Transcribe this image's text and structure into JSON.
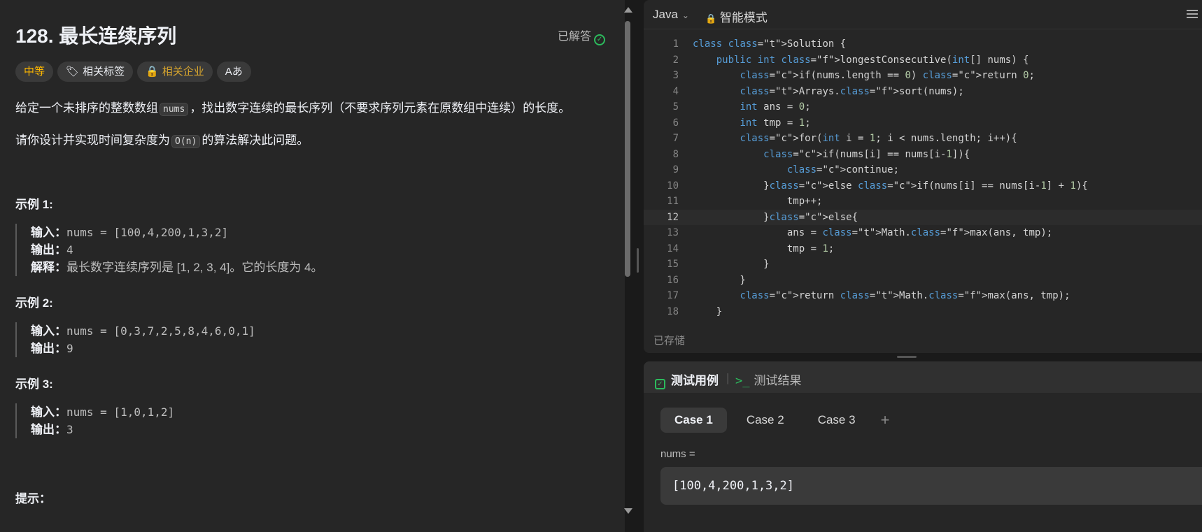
{
  "problem": {
    "title": "128. 最长连续序列",
    "solved_label": "已解答",
    "tags": {
      "difficulty": "中等",
      "related_tags": "相关标签",
      "companies": "相关企业",
      "font_icon": "Aあ"
    },
    "desc1_pre": "给定一个未排序的整数数组",
    "desc1_code": "nums",
    "desc1_post": "，找出数字连续的最长序列（不要求序列元素在原数组中连续）的长度。",
    "desc2_pre": "请你设计并实现时间复杂度为",
    "desc2_code": "O(n)",
    "desc2_post": "的算法解决此问题。",
    "examples": [
      {
        "heading": "示例 1:",
        "input_label": "输入：",
        "input": "nums = [100,4,200,1,3,2]",
        "output_label": "输出：",
        "output": "4",
        "explain_label": "解释：",
        "explain": "最长数字连续序列是 [1, 2, 3, 4]。它的长度为 4。"
      },
      {
        "heading": "示例 2:",
        "input_label": "输入：",
        "input": "nums = [0,3,7,2,5,8,4,6,0,1]",
        "output_label": "输出：",
        "output": "9"
      },
      {
        "heading": "示例 3:",
        "input_label": "输入：",
        "input": "nums = [1,0,1,2]",
        "output_label": "输出：",
        "output": "3"
      }
    ],
    "hint_heading": "提示："
  },
  "editor": {
    "language": "Java",
    "mode": "智能模式",
    "saved_label": "已存储",
    "current_line": 12,
    "lines": [
      "class Solution {",
      "    public int longestConsecutive(int[] nums) {",
      "        if(nums.length == 0) return 0;",
      "        Arrays.sort(nums);",
      "        int ans = 0;",
      "        int tmp = 1;",
      "        for(int i = 1; i < nums.length; i++){",
      "            if(nums[i] == nums[i-1]){",
      "                continue;",
      "            }else if(nums[i] == nums[i-1] + 1){",
      "                tmp++;",
      "            }else{",
      "                ans = Math.max(ans, tmp);",
      "                tmp = 1;",
      "            }",
      "        }",
      "        return Math.max(ans, tmp);",
      "    }"
    ]
  },
  "tests": {
    "tab_cases": "测试用例",
    "tab_results": "测试结果",
    "cases": [
      "Case 1",
      "Case 2",
      "Case 3"
    ],
    "active_case": 0,
    "var_label": "nums =",
    "var_value": "[100,4,200,1,3,2]"
  },
  "colors": {
    "accent_green": "#2cbb5d",
    "difficulty_medium": "#ffb800",
    "panel_bg": "#262626",
    "page_bg": "#1a1a1a"
  }
}
